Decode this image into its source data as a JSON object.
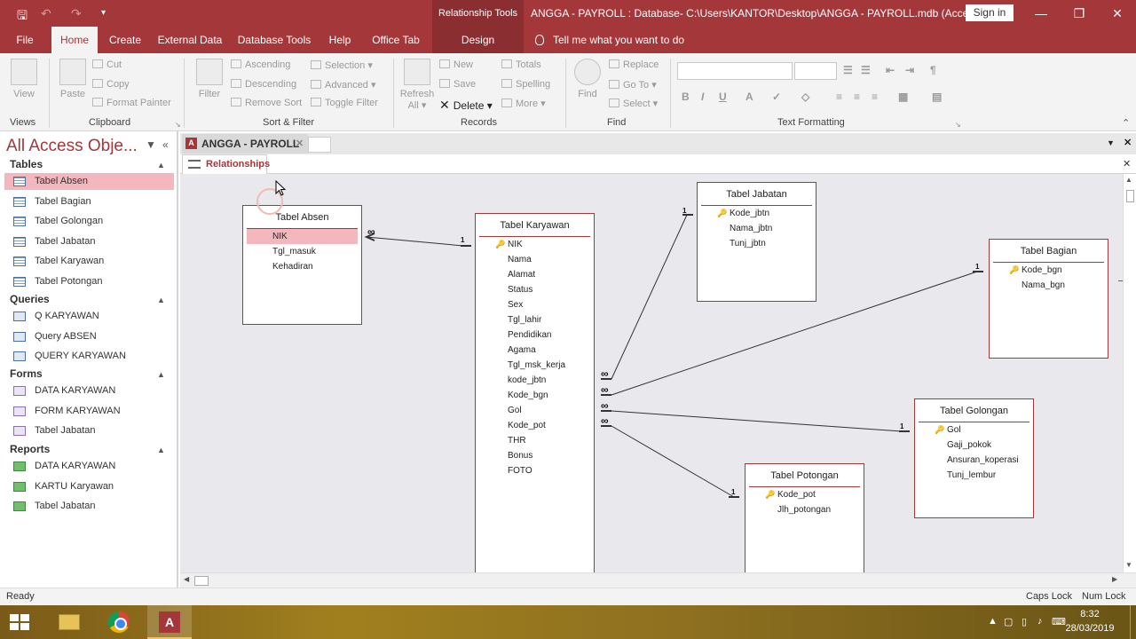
{
  "titlebar": {
    "context_tab": "Relationship Tools",
    "window_title": "ANGGA - PAYROLL : Database- C:\\Users\\KANTOR\\Desktop\\ANGGA - PAYROLL.mdb (Access 2...",
    "signin_label": "Sign in"
  },
  "ribbon_tabs": {
    "file": "File",
    "home": "Home",
    "create": "Create",
    "external": "External Data",
    "dbtools": "Database Tools",
    "help": "Help",
    "officetab": "Office Tab",
    "design": "Design",
    "tellme": "Tell me what you want to do"
  },
  "ribbon": {
    "views": {
      "view": "View",
      "label": "Views"
    },
    "clipboard": {
      "paste": "Paste",
      "cut": "Cut",
      "copy": "Copy",
      "format_painter": "Format Painter",
      "label": "Clipboard"
    },
    "sort_filter": {
      "filter": "Filter",
      "ascending": "Ascending",
      "descending": "Descending",
      "remove_sort": "Remove Sort",
      "selection": "Selection",
      "advanced": "Advanced",
      "toggle_filter": "Toggle Filter",
      "label": "Sort & Filter"
    },
    "records": {
      "refresh": "Refresh",
      "refresh_all": "All",
      "new": "New",
      "save": "Save",
      "delete": "Delete",
      "totals": "Totals",
      "spelling": "Spelling",
      "more": "More",
      "label": "Records"
    },
    "find": {
      "find": "Find",
      "replace": "Replace",
      "goto": "Go To",
      "select": "Select",
      "label": "Find"
    },
    "text_formatting": {
      "label": "Text Formatting"
    }
  },
  "nav": {
    "title": "All Access Obje...",
    "sections": {
      "tables": {
        "label": "Tables",
        "items": [
          "Tabel Absen",
          "Tabel Bagian",
          "Tabel Golongan",
          "Tabel Jabatan",
          "Tabel Karyawan",
          "Tabel Potongan"
        ]
      },
      "queries": {
        "label": "Queries",
        "items": [
          "Q KARYAWAN",
          "Query ABSEN",
          "QUERY KARYAWAN"
        ]
      },
      "forms": {
        "label": "Forms",
        "items": [
          "DATA KARYAWAN",
          "FORM KARYAWAN",
          "Tabel Jabatan"
        ]
      },
      "reports": {
        "label": "Reports",
        "items": [
          "DATA KARYAWAN",
          "KARTU Karyawan",
          "Tabel Jabatan"
        ]
      }
    },
    "selected_item": "Tabel Absen"
  },
  "document": {
    "db_tab": "ANGGA - PAYROLL",
    "object_tab": "Relationships"
  },
  "tables": {
    "absen": {
      "title": "Tabel Absen",
      "fields": [
        "NIK",
        "Tgl_masuk",
        "Kehadiran"
      ]
    },
    "karyawan": {
      "title": "Tabel Karyawan",
      "fields": [
        "NIK",
        "Nama",
        "Alamat",
        "Status",
        "Sex",
        "Tgl_lahir",
        "Pendidikan",
        "Agama",
        "Tgl_msk_kerja",
        "kode_jbtn",
        "Kode_bgn",
        "Gol",
        "Kode_pot",
        "THR",
        "Bonus",
        "FOTO"
      ]
    },
    "jabatan": {
      "title": "Tabel Jabatan",
      "fields": [
        "Kode_jbtn",
        "Nama_jbtn",
        "Tunj_jbtn"
      ]
    },
    "bagian": {
      "title": "Tabel Bagian",
      "fields": [
        "Kode_bgn",
        "Nama_bgn"
      ]
    },
    "golongan": {
      "title": "Tabel Golongan",
      "fields": [
        "Gol",
        "Gaji_pokok",
        "Ansuran_koperasi",
        "Tunj_lembur"
      ]
    },
    "potongan": {
      "title": "Tabel Potongan",
      "fields": [
        "Kode_pot",
        "Jlh_potongan"
      ]
    }
  },
  "relationships": [
    {
      "from": "Tabel Absen.NIK",
      "to": "Tabel Karyawan.NIK",
      "one_side": "Tabel Karyawan",
      "one": "1",
      "many": "∞"
    },
    {
      "from": "Tabel Karyawan.kode_jbtn",
      "to": "Tabel Jabatan.Kode_jbtn",
      "one": "1",
      "many": "∞"
    },
    {
      "from": "Tabel Karyawan.Kode_bgn",
      "to": "Tabel Bagian.Kode_bgn",
      "one": "1",
      "many": "∞"
    },
    {
      "from": "Tabel Karyawan.Gol",
      "to": "Tabel Golongan.Gol",
      "one": "1",
      "many": "∞"
    },
    {
      "from": "Tabel Karyawan.Kode_pot",
      "to": "Tabel Potongan.Kode_pot",
      "one": "1",
      "many": "∞"
    }
  ],
  "statusbar": {
    "left": "Ready",
    "caps": "Caps Lock",
    "num": "Num Lock"
  },
  "taskbar": {
    "time": "8:32",
    "date": "28/03/2019"
  }
}
